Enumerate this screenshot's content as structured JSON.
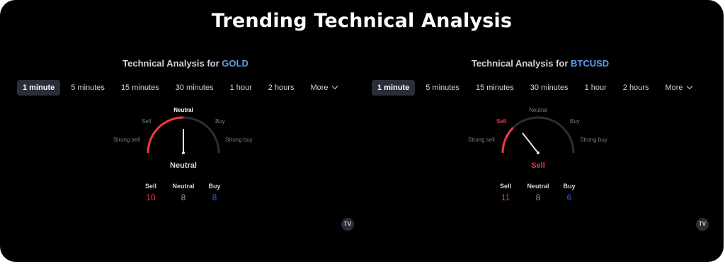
{
  "page": {
    "title": "Trending Technical Analysis"
  },
  "colors": {
    "sell": "#f23645",
    "neutral": "#9598a1",
    "buy": "#2962ff",
    "symbol": "#5b9cf6"
  },
  "tabs": [
    "1 minute",
    "5 minutes",
    "15 minutes",
    "30 minutes",
    "1 hour",
    "2 hours",
    "More"
  ],
  "widgets": [
    {
      "title_prefix": "Technical Analysis for ",
      "symbol": "GOLD",
      "active_tab": "1 minute",
      "gauge_labels": {
        "strong_sell": "Strong sell",
        "sell": "Sell",
        "neutral": "Neutral",
        "buy": "Buy",
        "strong_buy": "Strong buy"
      },
      "result": "Neutral",
      "counts": {
        "sell_label": "Sell",
        "sell": "10",
        "neutral_label": "Neutral",
        "neutral": "8",
        "buy_label": "Buy",
        "buy": "8"
      },
      "logo": "TV"
    },
    {
      "title_prefix": "Technical Analysis for ",
      "symbol": "BTCUSD",
      "active_tab": "1 minute",
      "gauge_labels": {
        "strong_sell": "Strong sell",
        "sell": "Sell",
        "neutral": "Neutral",
        "buy": "Buy",
        "strong_buy": "Strong buy"
      },
      "result": "Sell",
      "counts": {
        "sell_label": "Sell",
        "sell": "11",
        "neutral_label": "Neutral",
        "neutral": "8",
        "buy_label": "Buy",
        "buy": "6"
      },
      "logo": "TV"
    }
  ]
}
